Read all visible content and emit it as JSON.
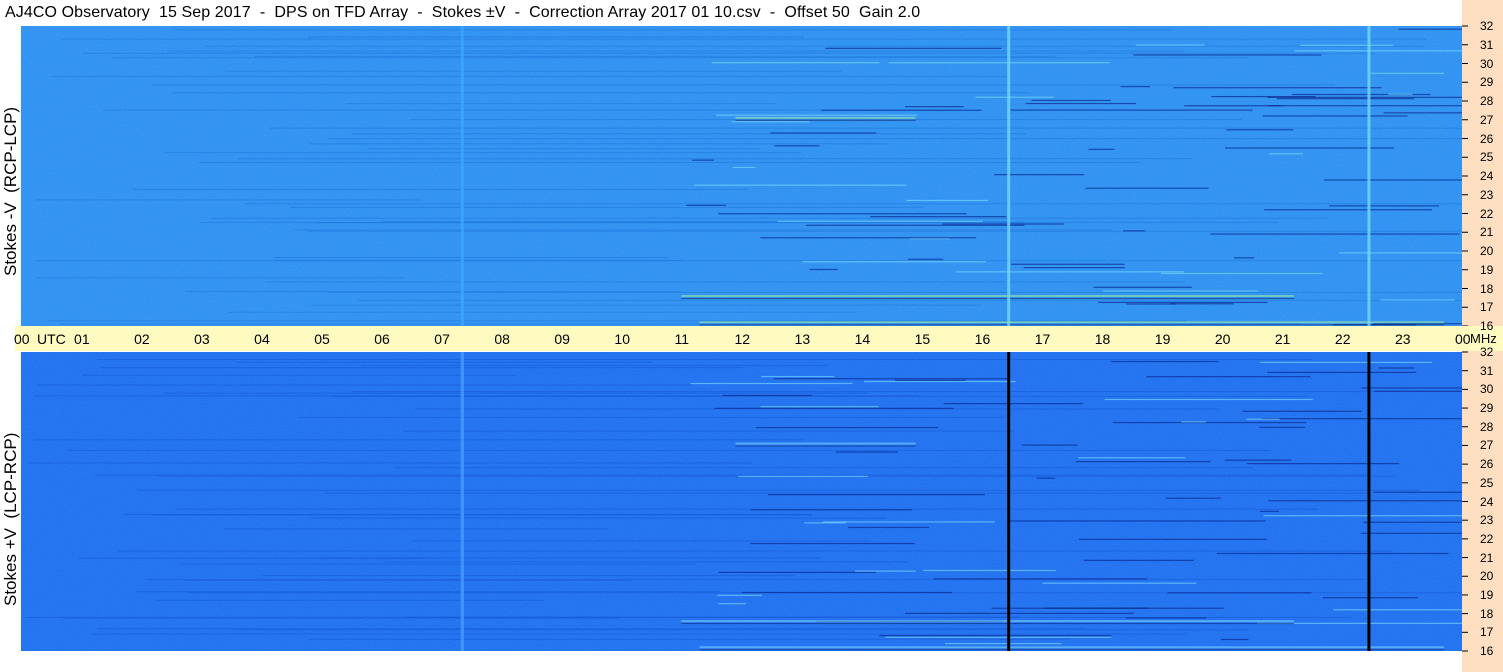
{
  "title": "AJ4CO Observatory  15 Sep 2017  -  DPS on TFD Array  -  Stokes ±V  -  Correction Array 2017 01 10.csv  -  Offset 50  Gain 2.0",
  "chart_data": [
    {
      "type": "heatmap",
      "panel": "top",
      "ylabel": "Stokes -V  (RCP-LCP)",
      "y_ticks": [
        "32",
        "31",
        "30",
        "29",
        "28",
        "27",
        "26",
        "25",
        "24",
        "23",
        "22",
        "21",
        "20",
        "19",
        "18",
        "17",
        "16"
      ],
      "x_ticks": [
        "00",
        "01",
        "02",
        "03",
        "04",
        "05",
        "06",
        "07",
        "08",
        "09",
        "10",
        "11",
        "12",
        "13",
        "14",
        "15",
        "16",
        "17",
        "18",
        "19",
        "20",
        "21",
        "22",
        "23",
        "00"
      ],
      "xlim_utc_hours": [
        0,
        24
      ],
      "ylim_mhz": [
        16,
        32
      ],
      "base_color": "#2d8ff0",
      "vertical_lines": [
        {
          "utc_hour": 7.35,
          "color": "#3aa8ff"
        },
        {
          "utc_hour": 16.45,
          "color": "#78d8ff"
        },
        {
          "utc_hour": 22.45,
          "color": "#78d8ff"
        }
      ]
    },
    {
      "type": "heatmap",
      "panel": "bottom",
      "ylabel": "Stokes +V  (LCP-RCP)",
      "y_ticks": [
        "32",
        "31",
        "30",
        "29",
        "28",
        "27",
        "26",
        "25",
        "24",
        "23",
        "22",
        "21",
        "20",
        "19",
        "18",
        "17",
        "16"
      ],
      "x_ticks": [
        "00",
        "01",
        "02",
        "03",
        "04",
        "05",
        "06",
        "07",
        "08",
        "09",
        "10",
        "11",
        "12",
        "13",
        "14",
        "15",
        "16",
        "17",
        "18",
        "19",
        "20",
        "21",
        "22",
        "23",
        "00"
      ],
      "xlim_utc_hours": [
        0,
        24
      ],
      "ylim_mhz": [
        16,
        32
      ],
      "base_color": "#1f6ff0",
      "vertical_lines": [
        {
          "utc_hour": 7.35,
          "color": "#4aa0ff"
        },
        {
          "utc_hour": 16.45,
          "color": "#000000"
        },
        {
          "utc_hour": 22.45,
          "color": "#000000"
        }
      ]
    }
  ],
  "time_axis": {
    "unit_label": "UTC",
    "end_unit_label": "MHz"
  }
}
